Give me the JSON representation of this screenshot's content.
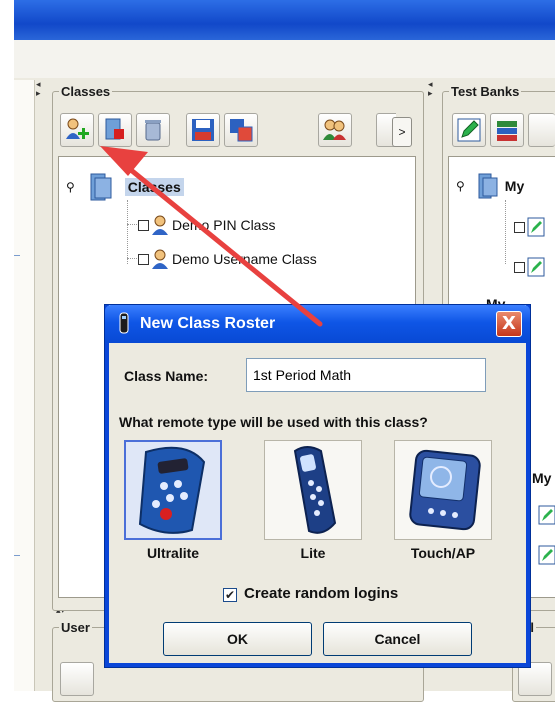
{
  "panels": {
    "classes_title": "Classes",
    "test_banks_title": "Test Banks",
    "users_title": "User",
    "cl_title": "Cl",
    "more_label": ">"
  },
  "classes_tree": {
    "root_label": "Classes",
    "items": [
      "Demo PIN Class",
      "Demo Username Class"
    ]
  },
  "test_banks_tree": {
    "root_label": "My",
    "sub_label": "My",
    "sub_label_2": "My"
  },
  "dialog": {
    "title": "New Class Roster",
    "close_label": "X",
    "class_name_label": "Class Name:",
    "class_name_value": "1st Period Math",
    "question": "What remote type will be used with this class?",
    "remotes": [
      {
        "label": "Ultralite",
        "selected": true
      },
      {
        "label": "Lite",
        "selected": false
      },
      {
        "label": "Touch/AP",
        "selected": false
      }
    ],
    "random_logins_label": "Create random logins",
    "random_logins_checked": true,
    "check_mark": "✔",
    "ok_label": "OK",
    "cancel_label": "Cancel"
  },
  "colors": {
    "annotation_arrow": "#e8413f",
    "title_blue": "#0f56e6"
  }
}
